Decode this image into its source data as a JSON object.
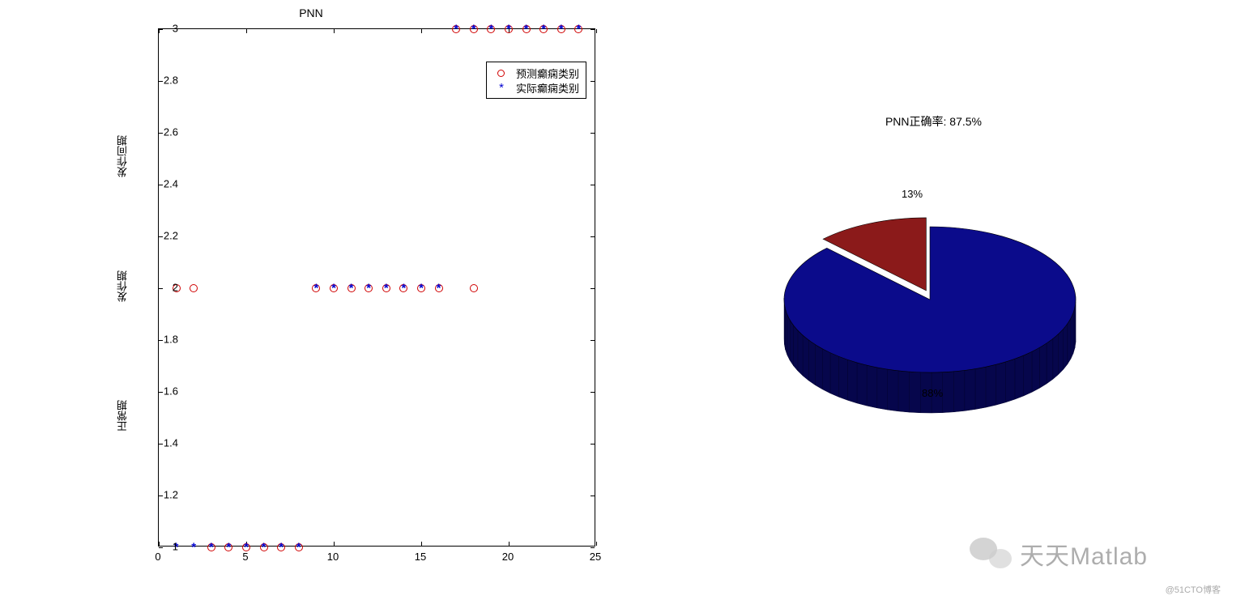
{
  "chart_data": [
    {
      "type": "scatter",
      "title": "PNN",
      "xlim": [
        0,
        25
      ],
      "ylim": [
        1,
        3
      ],
      "xticks": [
        0,
        5,
        10,
        15,
        20,
        25
      ],
      "yticks": [
        1,
        1.2,
        1.4,
        1.6,
        1.8,
        2,
        2.2,
        2.4,
        2.6,
        2.8,
        3
      ],
      "ylabels": [
        {
          "value": 1.5,
          "text": "正常期"
        },
        {
          "value": 2.0,
          "text": "发作期"
        },
        {
          "value": 2.5,
          "text": "发作间期"
        }
      ],
      "series": [
        {
          "name": "预测癫痫类别",
          "marker": "circle",
          "color": "#d00000",
          "points": [
            {
              "x": 1,
              "y": 2
            },
            {
              "x": 2,
              "y": 2
            },
            {
              "x": 3,
              "y": 1
            },
            {
              "x": 4,
              "y": 1
            },
            {
              "x": 5,
              "y": 1
            },
            {
              "x": 6,
              "y": 1
            },
            {
              "x": 7,
              "y": 1
            },
            {
              "x": 8,
              "y": 1
            },
            {
              "x": 9,
              "y": 2
            },
            {
              "x": 10,
              "y": 2
            },
            {
              "x": 11,
              "y": 2
            },
            {
              "x": 12,
              "y": 2
            },
            {
              "x": 13,
              "y": 2
            },
            {
              "x": 14,
              "y": 2
            },
            {
              "x": 15,
              "y": 2
            },
            {
              "x": 16,
              "y": 2
            },
            {
              "x": 17,
              "y": 3
            },
            {
              "x": 18,
              "y": 2
            },
            {
              "x": 18,
              "y": 3
            },
            {
              "x": 19,
              "y": 3
            },
            {
              "x": 20,
              "y": 3
            },
            {
              "x": 21,
              "y": 3
            },
            {
              "x": 22,
              "y": 3
            },
            {
              "x": 23,
              "y": 3
            },
            {
              "x": 24,
              "y": 3
            }
          ]
        },
        {
          "name": "实际癫痫类别",
          "marker": "star",
          "color": "#0000d0",
          "points": [
            {
              "x": 1,
              "y": 1
            },
            {
              "x": 2,
              "y": 1
            },
            {
              "x": 3,
              "y": 1
            },
            {
              "x": 4,
              "y": 1
            },
            {
              "x": 5,
              "y": 1
            },
            {
              "x": 6,
              "y": 1
            },
            {
              "x": 7,
              "y": 1
            },
            {
              "x": 8,
              "y": 1
            },
            {
              "x": 9,
              "y": 2
            },
            {
              "x": 10,
              "y": 2
            },
            {
              "x": 11,
              "y": 2
            },
            {
              "x": 12,
              "y": 2
            },
            {
              "x": 13,
              "y": 2
            },
            {
              "x": 14,
              "y": 2
            },
            {
              "x": 15,
              "y": 2
            },
            {
              "x": 16,
              "y": 2
            },
            {
              "x": 17,
              "y": 3
            },
            {
              "x": 18,
              "y": 3
            },
            {
              "x": 19,
              "y": 3
            },
            {
              "x": 20,
              "y": 3
            },
            {
              "x": 21,
              "y": 3
            },
            {
              "x": 22,
              "y": 3
            },
            {
              "x": 23,
              "y": 3
            },
            {
              "x": 24,
              "y": 3
            }
          ]
        }
      ],
      "legend": [
        "预测癫痫类别",
        "实际癫痫类别"
      ]
    },
    {
      "type": "pie",
      "title": "PNN正确率: 87.5%",
      "slices": [
        {
          "label": "13%",
          "value": 12.5,
          "color": "#8b1a1a"
        },
        {
          "label": "88%",
          "value": 87.5,
          "color": "#0b0b8b"
        }
      ]
    }
  ],
  "watermark": {
    "main": "天天Matlab",
    "sub": "@51CTO博客"
  }
}
